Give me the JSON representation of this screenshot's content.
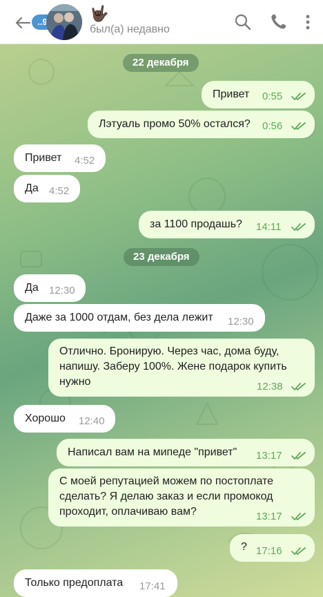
{
  "header": {
    "unread_count": "..98",
    "name_emoji": "🤟🏿",
    "status": "был(а) недавно"
  },
  "colors": {
    "badge": "#4a95d6",
    "outgoing_bubble": "#effdde",
    "incoming_bubble": "#ffffff",
    "check": "#5fa85a"
  },
  "messages": [
    {
      "type": "date",
      "text": "22 декабря"
    },
    {
      "type": "out",
      "text": "Привет",
      "time": "0:55",
      "read": true
    },
    {
      "type": "out",
      "text": "Лэтуаль промо 50% остался?",
      "time": "0:56",
      "read": true
    },
    {
      "type": "in",
      "text": "Привет",
      "time": "4:52"
    },
    {
      "type": "in",
      "text": "Да",
      "time": "4:52"
    },
    {
      "type": "out",
      "text": "за 1100 продашь?",
      "time": "14:11",
      "read": true
    },
    {
      "type": "date",
      "text": "23 декабря"
    },
    {
      "type": "in",
      "text": "Да",
      "time": "12:30"
    },
    {
      "type": "in",
      "text": "Даже за 1000 отдам, без дела лежит",
      "time": "12:30"
    },
    {
      "type": "out",
      "text": "Отлично. Бронирую. Через час, дома буду,\nнапишу. Заберу 100%. Жене подарок купить\nнужно",
      "time": "12:38",
      "read": true
    },
    {
      "type": "in",
      "text": "Хорошо",
      "time": "12:40"
    },
    {
      "type": "out",
      "text": "Написал вам на мипеде \"привет\"",
      "time": "13:17",
      "read": true
    },
    {
      "type": "out",
      "text": "С моей репутацией можем по постоплате\nсделать? Я делаю заказ и если промокод\nпроходит, оплачиваю вам?",
      "time": "13:17",
      "read": true
    },
    {
      "type": "out",
      "text": "?",
      "time": "17:16",
      "read": true
    },
    {
      "type": "in",
      "text": "Только предоплата",
      "time": "17:41"
    }
  ]
}
